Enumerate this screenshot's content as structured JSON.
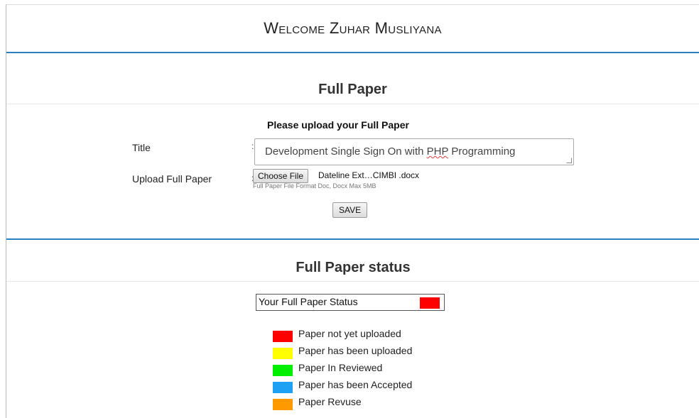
{
  "header": {
    "welcome": "Welcome Zuhar Musliyana"
  },
  "upload_section": {
    "title": "Full Paper",
    "heading": "Please upload your Full Paper",
    "title_label": "Title",
    "upload_label": "Upload Full Paper",
    "colon": ":",
    "title_value_pre": "Development Single Sign On with ",
    "title_value_misspelled": "PHP",
    "title_value_post": " Programming",
    "choose_file_label": "Choose File",
    "file_name": "Dateline Ext…CIMBI .docx",
    "file_hint": "Full Paper File Format Doc, Docx Max 5MB",
    "save_label": "SAVE"
  },
  "status_section": {
    "title": "Full Paper status",
    "status_label": "Your Full Paper Status",
    "status_color": "#ff0000",
    "legend": [
      {
        "label": "Paper not yet uploaded",
        "color": "#ff0000"
      },
      {
        "label": "Paper has been uploaded",
        "color": "#ffff00"
      },
      {
        "label": "Paper In Reviewed",
        "color": "#00ee00"
      },
      {
        "label": "Paper has been Accepted",
        "color": "#1ea0f5"
      },
      {
        "label": "Paper Revuse",
        "color": "#ff9900"
      }
    ]
  },
  "colors": {
    "accent_rule": "#2a7fc0"
  }
}
